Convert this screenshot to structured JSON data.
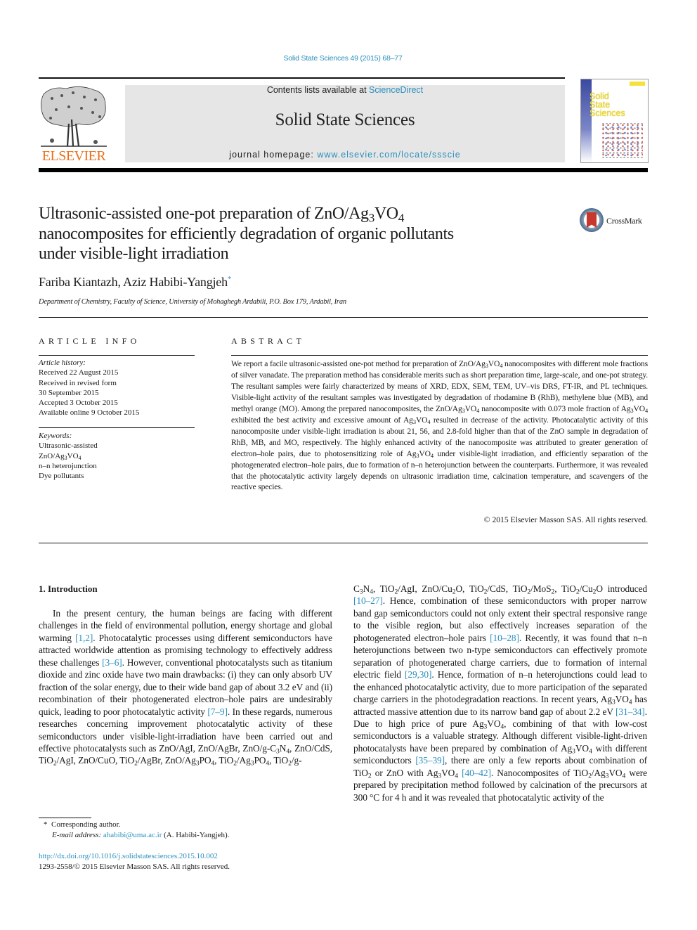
{
  "header": {
    "journal_citation": "Solid State Sciences 49 (2015) 68–77",
    "contents_prefix": "Contents lists available at ",
    "contents_link": "ScienceDirect",
    "journal_name": "Solid State Sciences",
    "homepage_prefix": "journal homepage: ",
    "homepage_link": "www.elsevier.com/locate/ssscie",
    "publisher_wordmark": "ELSEVIER",
    "cover_title_lines": [
      "Solid",
      "State",
      "Sciences"
    ],
    "crossmark_label": "CrossMark",
    "colors": {
      "link": "#2a8fbd",
      "elsevier_orange": "#e9711c",
      "masthead_gray": "#e6e6e6"
    }
  },
  "article": {
    "title_line1_pre": "Ultrasonic-assisted one-pot preparation of ZnO/Ag",
    "title_line1_sub1": "3",
    "title_line1_mid": "VO",
    "title_line1_sub2": "4",
    "title_line2": "nanocomposites for efficiently degradation of organic pollutants",
    "title_line3": "under visible-light irradiation",
    "authors": "Fariba Kiantazh, Aziz Habibi-Yangjeh",
    "corresponding_marker": "*",
    "affiliation": "Department of Chemistry, Faculty of Science, University of Mohaghegh Ardabili, P.O. Box 179, Ardabil, Iran"
  },
  "article_info": {
    "heading": "ARTICLE INFO",
    "history_label": "Article history:",
    "history": [
      "Received 22 August 2015",
      "Received in revised form",
      "30 September 2015",
      "Accepted 3 October 2015",
      "Available online 9 October 2015"
    ],
    "keywords_label": "Keywords:",
    "keywords": [
      "Ultrasonic-assisted",
      "ZnO/Ag3VO4",
      "n–n heterojunction",
      "Dye pollutants"
    ]
  },
  "abstract": {
    "heading": "ABSTRACT",
    "copyright": "© 2015 Elsevier Masson SAS. All rights reserved."
  },
  "introduction": {
    "heading": "1.  Introduction",
    "refs": [
      "[1,2]",
      "[3–6]",
      "[7–9]",
      "[10–27]",
      "[10–28]",
      "[29,30]",
      "[31–34]",
      "[35–39]",
      "[40–42]"
    ]
  },
  "footnote": {
    "marker": "*",
    "corresponding": "Corresponding author.",
    "email_label": "E-mail address:",
    "email": "ahabibi@uma.ac.ir",
    "email_owner": "(A. Habibi-Yangjeh)."
  },
  "doi": {
    "url": "http://dx.doi.org/10.1016/j.solidstatesciences.2015.10.002",
    "issn_line": "1293-2558/© 2015 Elsevier Masson SAS. All rights reserved."
  }
}
